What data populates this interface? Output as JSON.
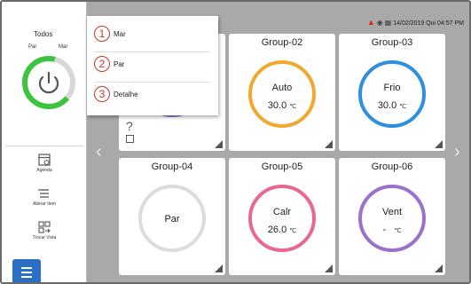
{
  "sidebar": {
    "title": "Todos",
    "par_label": "Par",
    "mar_label": "Mar",
    "power_icon": "power-icon",
    "buttons": [
      {
        "label": "Agenda",
        "icon": "calendar-icon"
      },
      {
        "label": "Alterar Item",
        "icon": "list-edit-icon"
      },
      {
        "label": "Trocar Vista",
        "icon": "switch-view-icon"
      }
    ],
    "menu_icon": "hamburger-menu-icon",
    "accent": "#2b6fc4"
  },
  "status_bar": {
    "alert_icon": "warning-triangle-icon",
    "icons": [
      "shield-icon",
      "schedule-icon"
    ],
    "datetime": "14/02/2019 Qui 04:57 PM"
  },
  "popup_menu": {
    "items": [
      {
        "number": "1",
        "label": "Mar"
      },
      {
        "number": "2",
        "label": "Par"
      },
      {
        "number": "3",
        "label": "Detalhe"
      }
    ]
  },
  "groups": [
    {
      "name": "Group-02",
      "mode": "Auto",
      "temp": "30.0",
      "unit": "℃",
      "color": "#f0a830"
    },
    {
      "name": "Group-03",
      "mode": "Frio",
      "temp": "30.0",
      "unit": "℃",
      "color": "#2e8fe0"
    },
    {
      "name": "Group-04",
      "mode": "Par",
      "temp": "",
      "unit": "",
      "color": "#dcdcdc"
    },
    {
      "name": "Group-05",
      "mode": "Calr",
      "temp": "26.0",
      "unit": "℃",
      "color": "#e86890"
    },
    {
      "name": "Group-06",
      "mode": "Vent",
      "temp": "-",
      "unit": "℃",
      "color": "#9a72cc"
    }
  ],
  "hidden_card": {
    "symbol": "?",
    "color": "#8a7ad8"
  },
  "nav": {
    "prev": "‹",
    "next": "›"
  }
}
